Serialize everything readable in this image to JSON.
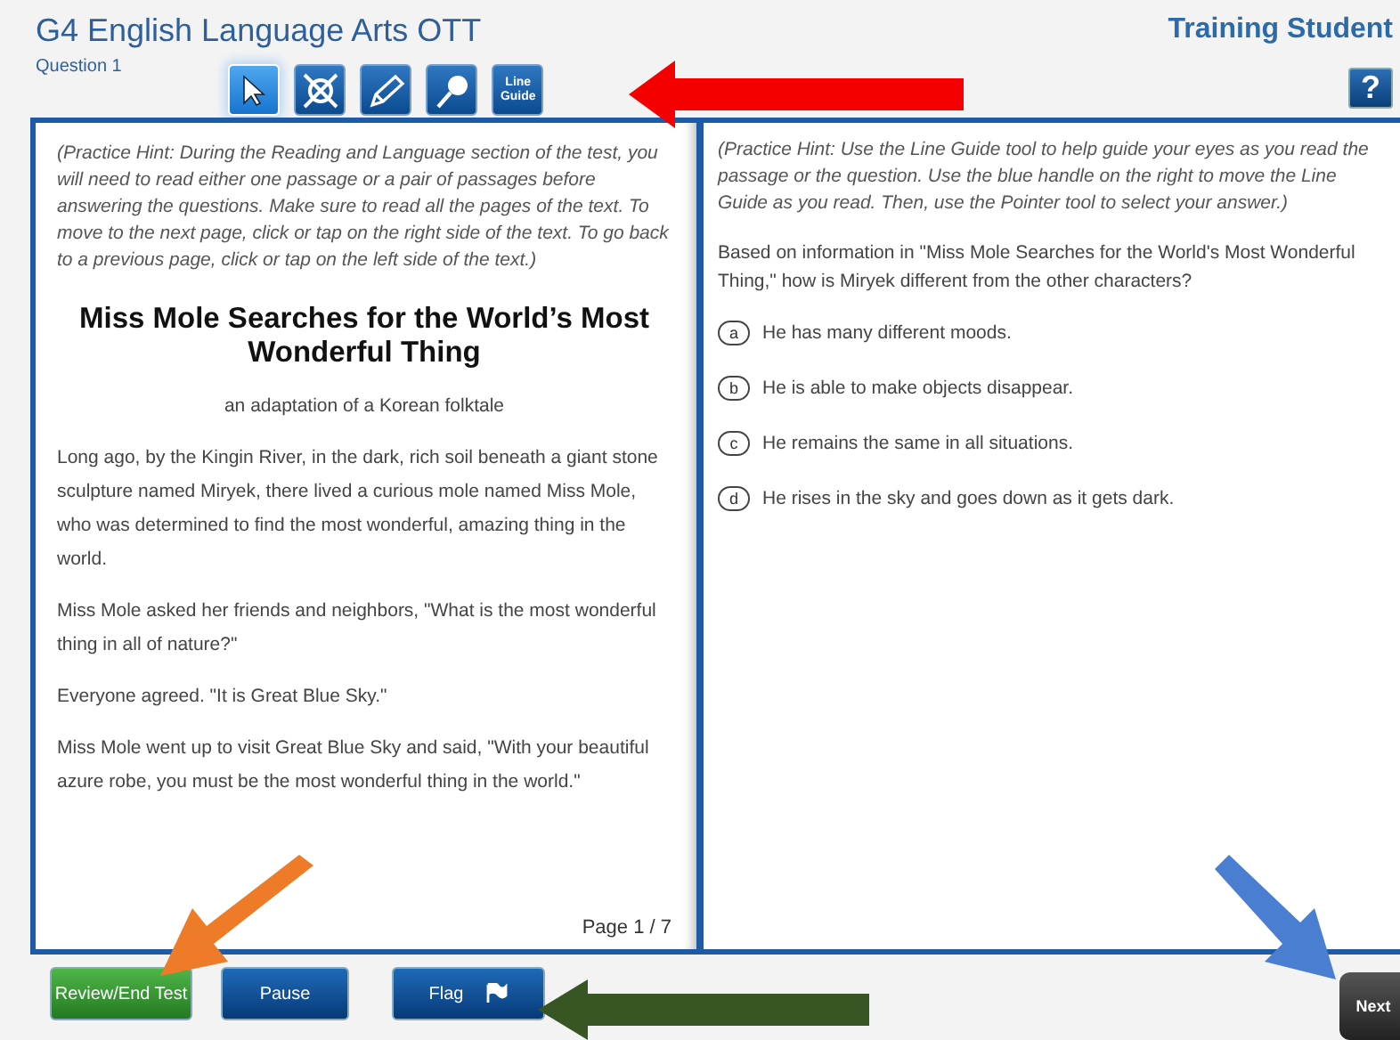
{
  "header": {
    "title": "G4 English Language Arts OTT",
    "question_label": "Question 1",
    "user_name": "Training Student",
    "help": "?"
  },
  "tools": [
    {
      "kind": "pointer",
      "selected": true
    },
    {
      "kind": "eliminator",
      "selected": false
    },
    {
      "kind": "highlighter",
      "selected": false
    },
    {
      "kind": "magnifier",
      "selected": false
    },
    {
      "kind": "line-guide",
      "label": "Line Guide",
      "selected": false
    }
  ],
  "passage": {
    "hint": "(Practice Hint: During the Reading and Language section of the test, you will need to read either one passage or a pair of passages before answering the questions. Make sure to read all the pages of the text. To move to the next page, click or tap on the right side of the text. To go back to a previous page, click or tap on the left side of the text.)",
    "title": "Miss Mole Searches for the World’s Most Wonderful Thing",
    "subtitle": "an adaptation of a Korean folktale",
    "paragraphs": [
      "Long ago, by the Kingin River, in the dark, rich soil beneath a giant stone sculpture named Miryek, there lived a curious mole named Miss Mole, who was determined to find the most wonderful, amazing thing in the world.",
      "Miss Mole asked her friends and neighbors, \"What is the most wonderful thing in all of nature?\"",
      "Everyone agreed. \"It is Great Blue Sky.\"",
      "Miss Mole went up to visit Great Blue Sky and said, \"With your beautiful azure robe, you must be the most wonderful thing in the world.\""
    ],
    "page": "Page 1 / 7"
  },
  "question": {
    "hint": "(Practice Hint: Use the Line Guide tool to help guide your eyes as you read the passage or the question. Use the blue handle on the right to move the Line Guide as you read. Then, use the Pointer tool to select your answer.)",
    "stem": "Based on information in \"Miss Mole Searches for the World's Most Wonderful Thing,\" how is Miryek different from the other characters?",
    "options": [
      {
        "letter": "a",
        "text": "He has many different moods.",
        "selected": false
      },
      {
        "letter": "b",
        "text": "He is able to make objects disappear.",
        "selected": false
      },
      {
        "letter": "c",
        "text": "He remains the same in all situations.",
        "selected": false
      },
      {
        "letter": "d",
        "text": "He rises in the sky and goes down as it gets dark.",
        "selected": false
      }
    ]
  },
  "footer": {
    "buttons": [
      {
        "kind": "review",
        "label": "Review/End Test"
      },
      {
        "kind": "pause",
        "label": "Pause"
      },
      {
        "kind": "flag",
        "label": "Flag"
      }
    ],
    "next": "Next"
  }
}
